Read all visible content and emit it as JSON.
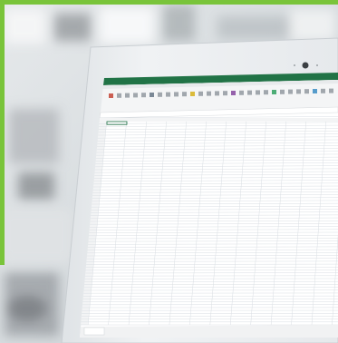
{
  "photo": {
    "subject": "laptop-with-spreadsheet",
    "colors": {
      "frame_green": "#79C43A",
      "excel_green": "#217346",
      "laptop_silver": "#E9ECEF",
      "screen_white": "#FFFFFF",
      "gridline": "#D9DEE3",
      "background_blur": "#D8DDE0"
    }
  },
  "spreadsheet": {
    "app": "Excel",
    "rows_visible": 72,
    "columns_visible": 13,
    "name_box": "",
    "sheet_tab": ""
  }
}
